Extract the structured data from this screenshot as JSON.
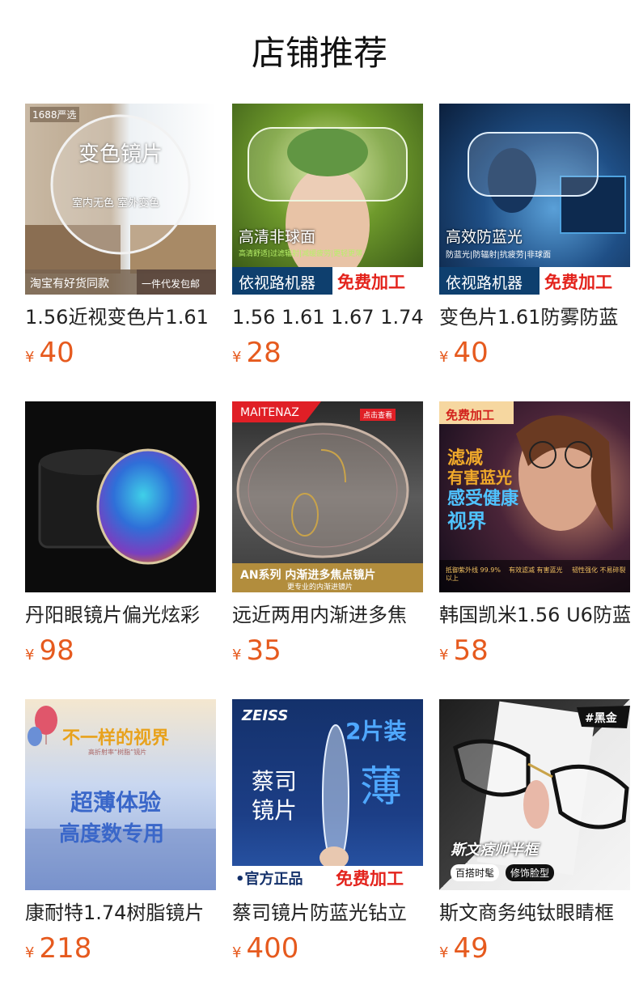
{
  "page_title": "店铺推荐",
  "currency_symbol": "¥",
  "products": [
    {
      "title": "1.56近视变色片1.61",
      "price": "40",
      "thumb": {
        "corner": "1688严选",
        "main": "变色镜片",
        "sub": "室内无色 室外变色",
        "bottom_left": "淘宝有好货同款",
        "bottom_right": "一件代发包邮"
      }
    },
    {
      "title": "1.56 1.61 1.67 1.74",
      "price": "28",
      "thumb": {
        "main": "高清非球面",
        "sub": "高清舒适|过滤辐射|减缓疲劳|更轻更薄",
        "bottom_left": "依视路机器",
        "bottom_right": "免费加工"
      }
    },
    {
      "title": "变色片1.61防雾防蓝",
      "price": "40",
      "thumb": {
        "main": "高效防蓝光",
        "sub": "防蓝光|防辐射|抗疲劳|非球面",
        "bottom_left": "依视路机器",
        "bottom_right": "免费加工"
      }
    },
    {
      "title": "丹阳眼镜片偏光炫彩",
      "price": "98",
      "thumb": {}
    },
    {
      "title": "远近两用内渐进多焦",
      "price": "35",
      "thumb": {
        "corner": "MAITENAZ",
        "corner_right": "点击查看",
        "main": "AN系列 内渐进多焦点镜片",
        "sub": "更专业的内渐进镜片"
      }
    },
    {
      "title": "韩国凯米1.56 U6防蓝",
      "price": "58",
      "thumb": {
        "corner": "免费加工",
        "main1": "滤减",
        "main2": "有害蓝光",
        "main3": "感受健康",
        "main4": "视界",
        "feat1": "抵御紫外线 99.9%以上",
        "feat2": "有效滤减 有害蓝光",
        "feat3": "韧性强化 不易碎裂"
      }
    },
    {
      "title": "康耐特1.74树脂镜片",
      "price": "218",
      "thumb": {
        "top": "不一样的视界",
        "top_sub": "高折射率“树脂”镜片",
        "main1": "超薄体验",
        "main2": "高度数专用"
      }
    },
    {
      "title": "蔡司镜片防蓝光钻立",
      "price": "400",
      "thumb": {
        "brand": "ZEISS",
        "pack": "2片装",
        "main1": "蔡司",
        "main2": "镜片",
        "thin": "薄",
        "bottom_left": "•官方正品",
        "bottom_right": "免费加工"
      }
    },
    {
      "title": "斯文商务纯钛眼睛框",
      "price": "49",
      "thumb": {
        "tag": "#黑金",
        "main": "斯文痞帅半框",
        "pill1": "百搭时髦",
        "pill2": "修饰脸型"
      }
    }
  ],
  "colors": {
    "price": "#e65a1e",
    "title": "#222222",
    "heading": "#111111"
  }
}
